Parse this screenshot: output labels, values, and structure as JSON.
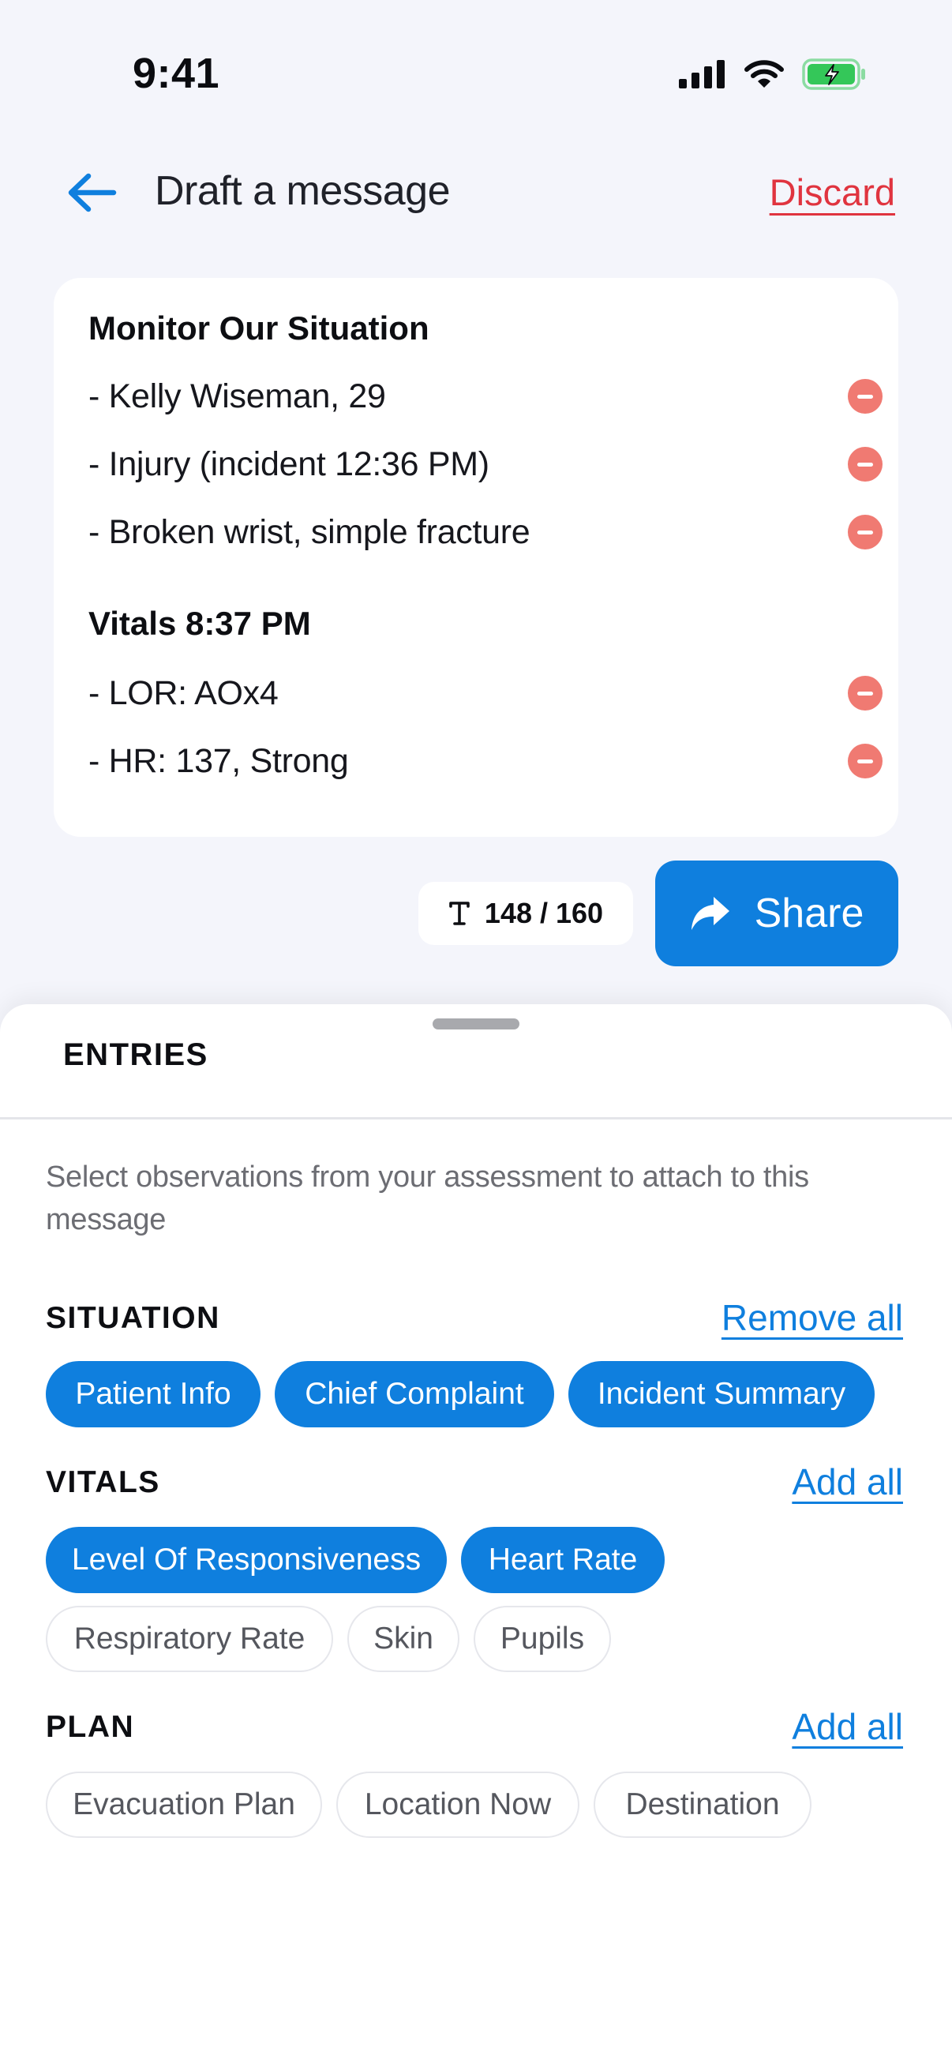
{
  "status_bar": {
    "time": "9:41"
  },
  "header": {
    "title": "Draft a message",
    "discard_label": "Discard"
  },
  "message": {
    "sections": [
      {
        "heading": "Monitor Our Situation",
        "lines": [
          "- Kelly Wiseman, 29",
          "- Injury (incident 12:36 PM)",
          "- Broken wrist, simple fracture"
        ]
      },
      {
        "heading": "Vitals 8:37 PM",
        "lines": [
          "- LOR: AOx4",
          "- HR: 137, Strong"
        ]
      }
    ]
  },
  "counter": {
    "text": "148 / 160"
  },
  "share": {
    "label": "Share"
  },
  "entries": {
    "title": "ENTRIES",
    "description": "Select observations from your assessment to attach to this message",
    "groups": [
      {
        "title": "SITUATION",
        "action": "Remove all",
        "chips": [
          {
            "label": "Patient Info",
            "selected": true
          },
          {
            "label": "Chief Complaint",
            "selected": true
          },
          {
            "label": "Incident Summary",
            "selected": true
          }
        ]
      },
      {
        "title": "VITALS",
        "action": "Add all",
        "chips": [
          {
            "label": "Level Of Responsiveness",
            "selected": true
          },
          {
            "label": "Heart Rate",
            "selected": true
          },
          {
            "label": "Respiratory Rate",
            "selected": false
          },
          {
            "label": "Skin",
            "selected": false
          },
          {
            "label": "Pupils",
            "selected": false
          }
        ]
      },
      {
        "title": "PLAN",
        "action": "Add all",
        "chips": [
          {
            "label": "Evacuation Plan",
            "selected": false
          },
          {
            "label": "Location Now",
            "selected": false
          },
          {
            "label": "Destination",
            "selected": false
          }
        ]
      }
    ]
  },
  "colors": {
    "accent": "#0f7fde",
    "danger": "#e0343f",
    "remove_dot": "#f07a72",
    "battery": "#34c759"
  },
  "icons": {
    "back": "arrow-left-icon",
    "signal": "cellular-signal-icon",
    "wifi": "wifi-icon",
    "battery": "battery-charging-icon",
    "remove": "minus-circle-icon",
    "counter": "text-size-icon",
    "share": "share-arrow-icon"
  }
}
